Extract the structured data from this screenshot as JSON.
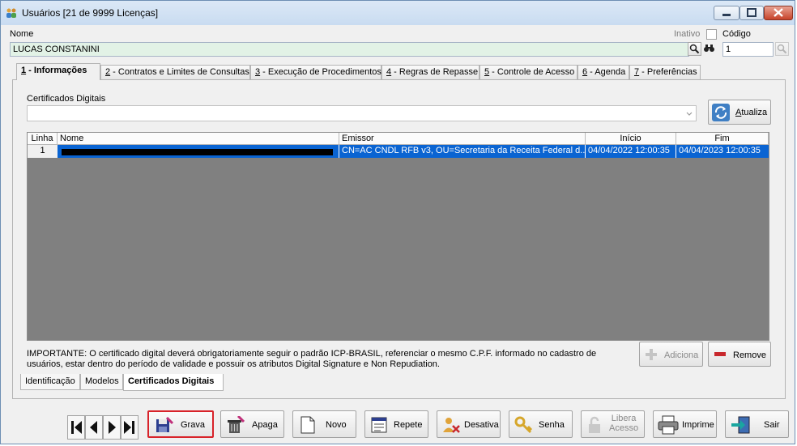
{
  "window": {
    "title": "Usuários [21 de 9999 Licenças]"
  },
  "form": {
    "name_label": "Nome",
    "name_value": "LUCAS CONSTANINI",
    "inativo_label": "Inativo",
    "codigo_label": "Código",
    "codigo_value": "1"
  },
  "tabs": [
    {
      "num": "1",
      "label": " - Informações"
    },
    {
      "num": "2",
      "label": " - Contratos e Limites de Consultas"
    },
    {
      "num": "3",
      "label": " - Execução de Procedimentos"
    },
    {
      "num": "4",
      "label": " - Regras de Repasse"
    },
    {
      "num": "5",
      "label": " - Controle de Acesso"
    },
    {
      "num": "6",
      "label": " - Agenda"
    },
    {
      "num": "7",
      "label": " - Preferências"
    }
  ],
  "certificates": {
    "label": "Certificados Digitais",
    "refresh_label": "Atualiza",
    "refresh_hotkey": "A",
    "refresh_rest": "tualiza",
    "columns": [
      "Linha",
      "Nome",
      "Emissor",
      "Início",
      "Fim"
    ],
    "rows": [
      {
        "linha": "1",
        "nome": "",
        "emissor": "CN=AC CNDL RFB v3, OU=Secretaria da Receita Federal d...",
        "inicio": "04/04/2022 12:00:35",
        "fim": "04/04/2023 12:00:35"
      }
    ],
    "note_line1": "IMPORTANTE: O certificado digital deverá obrigatoriamente seguir o padrão ICP-BRASIL, referenciar o mesmo C.P.F. informado no cadastro de",
    "note_line2": "usuários, estar dentro do período de validade e possuir os atributos Digital Signature e Non Repudiation.",
    "add_label": "Adiciona",
    "remove_label": "Remove"
  },
  "subtabs": [
    "Identificação",
    "Modelos",
    "Certificados Digitais"
  ],
  "toolbar": {
    "grava": "Grava",
    "apaga": "Apaga",
    "novo": "Novo",
    "repete": "Repete",
    "desativa": "Desativa",
    "senha": "Senha",
    "libera_line1": "Libera",
    "libera_line2": "Acesso",
    "imprime": "Imprime",
    "sair": "Sair"
  },
  "colors": {
    "accent": "#0a64d2",
    "highlight": "#d8232a",
    "grid_bg": "#808080",
    "name_field_bg": "#e2f2e6"
  }
}
